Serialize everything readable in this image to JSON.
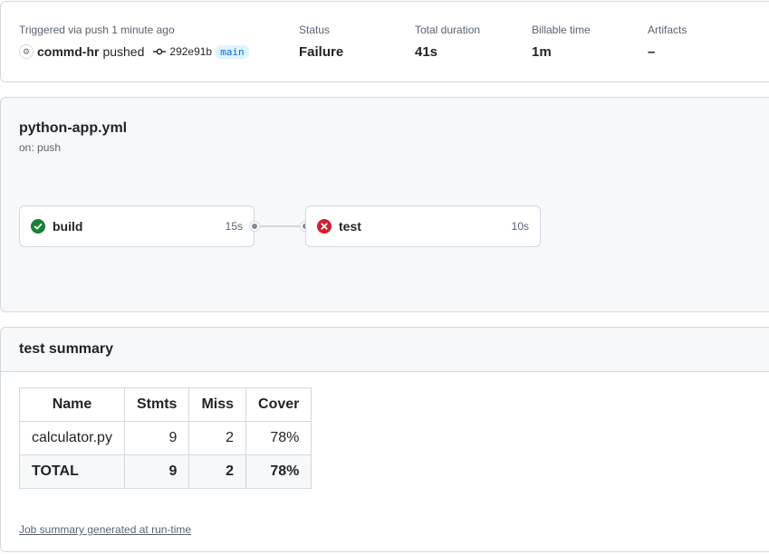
{
  "summary": {
    "trigger_label": "Triggered via push 1 minute ago",
    "actor": "commd-hr",
    "action": "pushed",
    "commit_sha": "292e91b",
    "branch": "main",
    "status_label": "Status",
    "status_value": "Failure",
    "duration_label": "Total duration",
    "duration_value": "41s",
    "billable_label": "Billable time",
    "billable_value": "1m",
    "artifacts_label": "Artifacts",
    "artifacts_value": "–"
  },
  "workflow": {
    "file": "python-app.yml",
    "trigger": "on: push",
    "jobs": [
      {
        "name": "build",
        "time": "15s",
        "status": "success",
        "icon": "check-circle-icon"
      },
      {
        "name": "test",
        "time": "10s",
        "status": "failure",
        "icon": "x-circle-icon"
      }
    ]
  },
  "test_summary": {
    "title": "test summary",
    "columns": [
      "Name",
      "Stmts",
      "Miss",
      "Cover"
    ],
    "rows": [
      [
        "calculator.py",
        "9",
        "2",
        "78%"
      ]
    ],
    "total": [
      "TOTAL",
      "9",
      "2",
      "78%"
    ],
    "footnote": "Job summary generated at run-time"
  },
  "colors": {
    "success": "#1a7f37",
    "failure": "#cf222e",
    "link": "#0969da",
    "muted": "#59636e",
    "border": "#d1d9e0"
  }
}
